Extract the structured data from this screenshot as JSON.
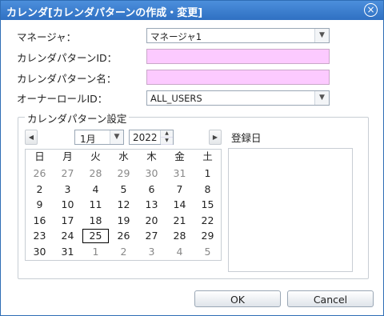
{
  "window": {
    "title": "カレンダ[カレンダパターンの作成・変更]",
    "close_icon": "close-icon"
  },
  "form": {
    "manager_label": "マネージャ：",
    "manager_value": "マネージャ1",
    "pattern_id_label": "カレンダパターンID：",
    "pattern_id_value": "",
    "pattern_name_label": "カレンダパターン名：",
    "pattern_name_value": "",
    "owner_role_label": "オーナーロールID：",
    "owner_role_value": "ALL_USERS"
  },
  "settings": {
    "legend": "カレンダパターン設定",
    "month": "1月",
    "year": "2022",
    "registered_label": "登録日"
  },
  "calendar": {
    "weekdays": [
      "日",
      "月",
      "火",
      "水",
      "木",
      "金",
      "土"
    ],
    "weeks": [
      [
        {
          "d": "26",
          "m": true
        },
        {
          "d": "27",
          "m": true
        },
        {
          "d": "28",
          "m": true
        },
        {
          "d": "29",
          "m": true
        },
        {
          "d": "30",
          "m": true
        },
        {
          "d": "31",
          "m": true
        },
        {
          "d": "1",
          "m": false
        }
      ],
      [
        {
          "d": "2",
          "m": false
        },
        {
          "d": "3",
          "m": false
        },
        {
          "d": "4",
          "m": false
        },
        {
          "d": "5",
          "m": false
        },
        {
          "d": "6",
          "m": false
        },
        {
          "d": "7",
          "m": false
        },
        {
          "d": "8",
          "m": false
        }
      ],
      [
        {
          "d": "9",
          "m": false
        },
        {
          "d": "10",
          "m": false
        },
        {
          "d": "11",
          "m": false
        },
        {
          "d": "12",
          "m": false
        },
        {
          "d": "13",
          "m": false
        },
        {
          "d": "14",
          "m": false
        },
        {
          "d": "15",
          "m": false
        }
      ],
      [
        {
          "d": "16",
          "m": false
        },
        {
          "d": "17",
          "m": false
        },
        {
          "d": "18",
          "m": false
        },
        {
          "d": "19",
          "m": false
        },
        {
          "d": "20",
          "m": false
        },
        {
          "d": "21",
          "m": false
        },
        {
          "d": "22",
          "m": false
        }
      ],
      [
        {
          "d": "23",
          "m": false
        },
        {
          "d": "24",
          "m": false
        },
        {
          "d": "25",
          "m": false,
          "today": true
        },
        {
          "d": "26",
          "m": false
        },
        {
          "d": "27",
          "m": false
        },
        {
          "d": "28",
          "m": false
        },
        {
          "d": "29",
          "m": false
        }
      ],
      [
        {
          "d": "30",
          "m": false
        },
        {
          "d": "31",
          "m": false
        },
        {
          "d": "1",
          "m": true
        },
        {
          "d": "2",
          "m": true
        },
        {
          "d": "3",
          "m": true
        },
        {
          "d": "4",
          "m": true
        },
        {
          "d": "5",
          "m": true
        }
      ]
    ]
  },
  "buttons": {
    "ok": "OK",
    "cancel": "Cancel"
  }
}
